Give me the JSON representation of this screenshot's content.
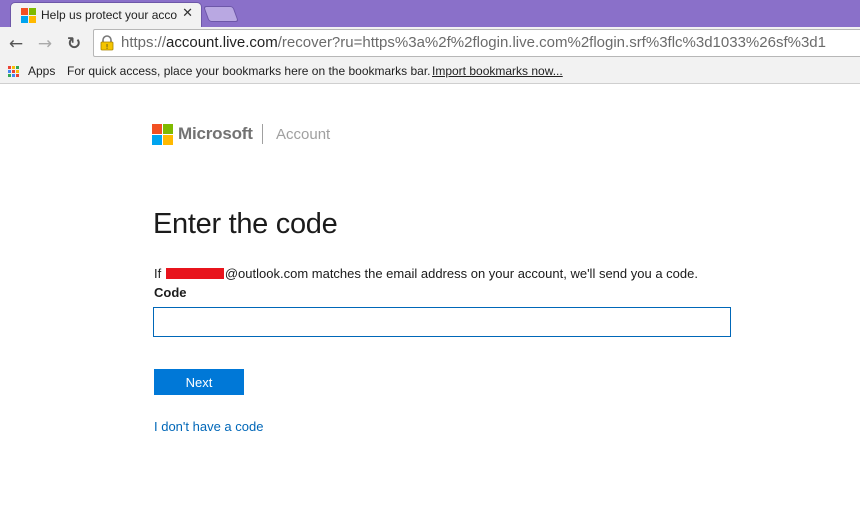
{
  "browser": {
    "tab_title": "Help us protect your acco",
    "tab_close": "✕",
    "url_scheme": "https://",
    "url_host": "account.live.com",
    "url_path": "/recover?ru=https%3a%2f%2flogin.live.com%2flogin.srf%3flc%3d1033%26sf%3d1",
    "back": "←",
    "forward": "→",
    "reload": "↻"
  },
  "bookmarks": {
    "apps_label": "Apps",
    "hint": "For quick access, place your bookmarks here on the bookmarks bar.",
    "import_link": "Import bookmarks now..."
  },
  "brand": {
    "company": "Microsoft",
    "product": "Account",
    "logo_colors": [
      "#f25022",
      "#7fba00",
      "#00a4ef",
      "#ffb900"
    ]
  },
  "page": {
    "heading": "Enter the code",
    "message_prefix": "If",
    "message_suffix": "@outlook.com matches the email address on your account, we'll send you a code.",
    "code_label": "Code",
    "code_value": "",
    "next_button": "Next",
    "no_code_link": "I don't have a code"
  }
}
